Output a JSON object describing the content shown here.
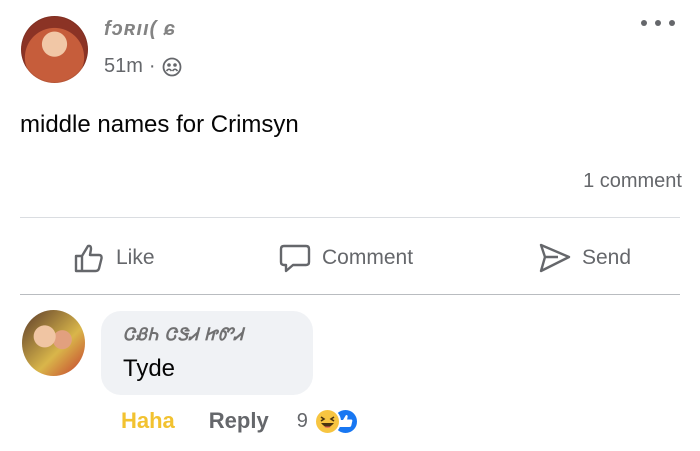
{
  "post": {
    "author": "fɔʀıı( ɕ",
    "time": "51m",
    "separator": "·",
    "text": "middle names for Crimsyn",
    "comment_count": "1 comment"
  },
  "actions": {
    "like": "Like",
    "comment": "Comment",
    "send": "Send"
  },
  "comment": {
    "author": "ᏣᏰᏂ ᏣᏕᏗ ᏥᏛᏗ",
    "text": "Tyde",
    "haha_label": "Haha",
    "reply_label": "Reply",
    "reaction_count": "9"
  },
  "colors": {
    "haha": "#f2c230",
    "like_blue": "#1877f2",
    "muted": "#65676b",
    "bubble": "#f0f2f5"
  }
}
